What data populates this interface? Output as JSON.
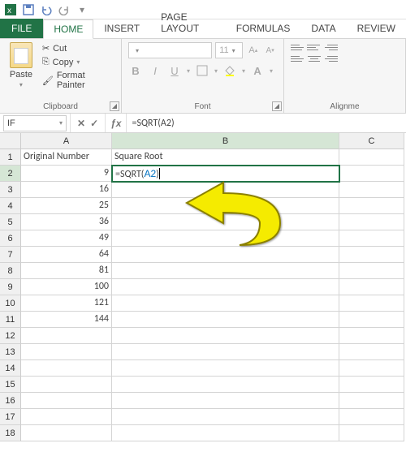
{
  "qat": {
    "save": "save-icon",
    "undo": "undo-icon",
    "redo": "redo-icon"
  },
  "tabs": {
    "file": "FILE",
    "home": "HOME",
    "insert": "INSERT",
    "pagelayout": "PAGE LAYOUT",
    "formulas": "FORMULAS",
    "data": "DATA",
    "review": "REVIEW"
  },
  "ribbon": {
    "clipboard": {
      "paste": "Paste",
      "cut": "Cut",
      "copy": "Copy",
      "fp": "Format Painter",
      "label": "Clipboard"
    },
    "font": {
      "name_placeholder": "",
      "size": "11",
      "label": "Font",
      "b": "B",
      "i": "I",
      "u": "U"
    },
    "alignment": {
      "label": "Alignme"
    }
  },
  "namebox": "IF",
  "formula_bar": "=SQRT(A2)",
  "columns": [
    "A",
    "B",
    "C"
  ],
  "headers": {
    "A": "Original Number",
    "B": "Square Root"
  },
  "active_cell": {
    "row": 2,
    "col": "B",
    "display_prefix": "=SQRT(",
    "ref": "A2",
    "display_suffix": ")"
  },
  "colA_values": {
    "2": "9",
    "3": "16",
    "4": "25",
    "5": "36",
    "6": "49",
    "7": "64",
    "8": "81",
    "9": "100",
    "10": "121",
    "11": "144"
  },
  "row_count": 18
}
